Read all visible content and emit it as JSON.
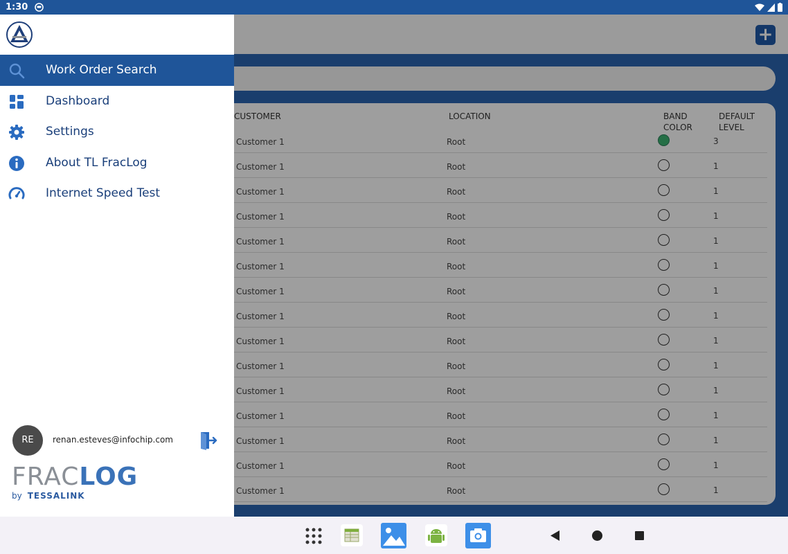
{
  "status_bar": {
    "time": "1:30"
  },
  "header": {
    "add_button_label": "+"
  },
  "table": {
    "headers": {
      "customer": "CUSTOMER",
      "location": "LOCATION",
      "band_color": "BAND\nCOLOR",
      "default_level": "DEFAULT\nLEVEL"
    },
    "rows": [
      {
        "customer": "Customer 1",
        "location": "Root",
        "band": "green",
        "level": "3"
      },
      {
        "customer": "Customer 1",
        "location": "Root",
        "band": "none",
        "level": "1"
      },
      {
        "customer": "Customer 1",
        "location": "Root",
        "band": "none",
        "level": "1"
      },
      {
        "customer": "Customer 1",
        "location": "Root",
        "band": "none",
        "level": "1"
      },
      {
        "customer": "Customer 1",
        "location": "Root",
        "band": "none",
        "level": "1"
      },
      {
        "customer": "Customer 1",
        "location": "Root",
        "band": "none",
        "level": "1"
      },
      {
        "customer": "Customer 1",
        "location": "Root",
        "band": "none",
        "level": "1"
      },
      {
        "customer": "Customer 1",
        "location": "Root",
        "band": "none",
        "level": "1"
      },
      {
        "customer": "Customer 1",
        "location": "Root",
        "band": "none",
        "level": "1"
      },
      {
        "customer": "Customer 1",
        "location": "Root",
        "band": "none",
        "level": "1"
      },
      {
        "customer": "Customer 1",
        "location": "Root",
        "band": "none",
        "level": "1"
      },
      {
        "customer": "Customer 1",
        "location": "Root",
        "band": "none",
        "level": "1"
      },
      {
        "customer": "Customer 1",
        "location": "Root",
        "band": "none",
        "level": "1"
      },
      {
        "customer": "Customer 1",
        "location": "Root",
        "band": "none",
        "level": "1"
      },
      {
        "customer": "Customer 1",
        "location": "Root",
        "band": "none",
        "level": "1"
      }
    ]
  },
  "drawer": {
    "menu": [
      {
        "label": "Work Order Search",
        "icon": "search-icon",
        "active": true
      },
      {
        "label": "Dashboard",
        "icon": "dashboard-icon",
        "active": false
      },
      {
        "label": "Settings",
        "icon": "gear-icon",
        "active": false
      },
      {
        "label": "About TL FracLog",
        "icon": "info-icon",
        "active": false
      },
      {
        "label": "Internet Speed Test",
        "icon": "speedometer-icon",
        "active": false
      }
    ],
    "user": {
      "initials": "RE",
      "email": "renan.esteves@infochip.com"
    },
    "brand": {
      "frac": "FRAC",
      "log": "LOG",
      "by": "by",
      "tessalink": "TESSALINK"
    }
  },
  "colors": {
    "primary": "#1f5599",
    "band_green": "#3cb371"
  }
}
